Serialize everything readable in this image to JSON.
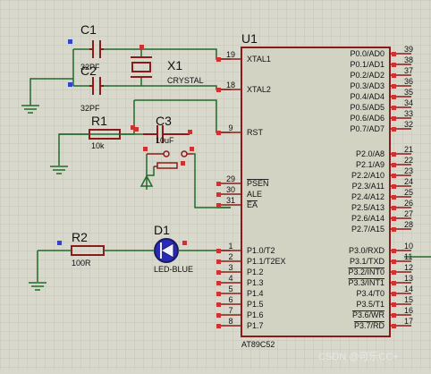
{
  "components": {
    "c1": {
      "ref": "C1",
      "value": "32PF"
    },
    "c2": {
      "ref": "C2",
      "value": "32PF"
    },
    "x1": {
      "ref": "X1",
      "value": "CRYSTAL"
    },
    "r1": {
      "ref": "R1",
      "value": "10k"
    },
    "c3": {
      "ref": "C3",
      "value": "10uF"
    },
    "r2": {
      "ref": "R2",
      "value": "100R"
    },
    "d1": {
      "ref": "D1",
      "value": "LED-BLUE"
    },
    "u1": {
      "ref": "U1",
      "value": "AT89C52"
    }
  },
  "pins_left": [
    {
      "num": "19",
      "name": "XTAL1"
    },
    {
      "num": "18",
      "name": "XTAL2"
    },
    {
      "num": "9",
      "name": "RST"
    },
    {
      "num": "29",
      "name": "PSEN"
    },
    {
      "num": "30",
      "name": "ALE"
    },
    {
      "num": "31",
      "name": "EA"
    },
    {
      "num": "1",
      "name": "P1.0/T2"
    },
    {
      "num": "2",
      "name": "P1.1/T2EX"
    },
    {
      "num": "3",
      "name": "P1.2"
    },
    {
      "num": "4",
      "name": "P1.3"
    },
    {
      "num": "5",
      "name": "P1.4"
    },
    {
      "num": "6",
      "name": "P1.5"
    },
    {
      "num": "7",
      "name": "P1.6"
    },
    {
      "num": "8",
      "name": "P1.7"
    }
  ],
  "pins_right": [
    {
      "num": "39",
      "name": "P0.0/AD0"
    },
    {
      "num": "38",
      "name": "P0.1/AD1"
    },
    {
      "num": "37",
      "name": "P0.2/AD2"
    },
    {
      "num": "36",
      "name": "P0.3/AD3"
    },
    {
      "num": "35",
      "name": "P0.4/AD4"
    },
    {
      "num": "34",
      "name": "P0.5/AD5"
    },
    {
      "num": "33",
      "name": "P0.6/AD6"
    },
    {
      "num": "32",
      "name": "P0.7/AD7"
    },
    {
      "num": "21",
      "name": "P2.0/A8"
    },
    {
      "num": "22",
      "name": "P2.1/A9"
    },
    {
      "num": "23",
      "name": "P2.2/A10"
    },
    {
      "num": "24",
      "name": "P2.3/A11"
    },
    {
      "num": "25",
      "name": "P2.4/A12"
    },
    {
      "num": "26",
      "name": "P2.5/A13"
    },
    {
      "num": "27",
      "name": "P2.6/A14"
    },
    {
      "num": "28",
      "name": "P2.7/A15"
    },
    {
      "num": "10",
      "name": "P3.0/RXD"
    },
    {
      "num": "11",
      "name": "P3.1/TXD"
    },
    {
      "num": "12",
      "name": "P3.2/INT0"
    },
    {
      "num": "13",
      "name": "P3.3/INT1"
    },
    {
      "num": "14",
      "name": "P3.4/T0"
    },
    {
      "num": "15",
      "name": "P3.5/T1"
    },
    {
      "num": "16",
      "name": "P3.6/WR"
    },
    {
      "num": "17",
      "name": "P3.7/RD"
    }
  ],
  "watermark": "CSDN @可乐CC+"
}
